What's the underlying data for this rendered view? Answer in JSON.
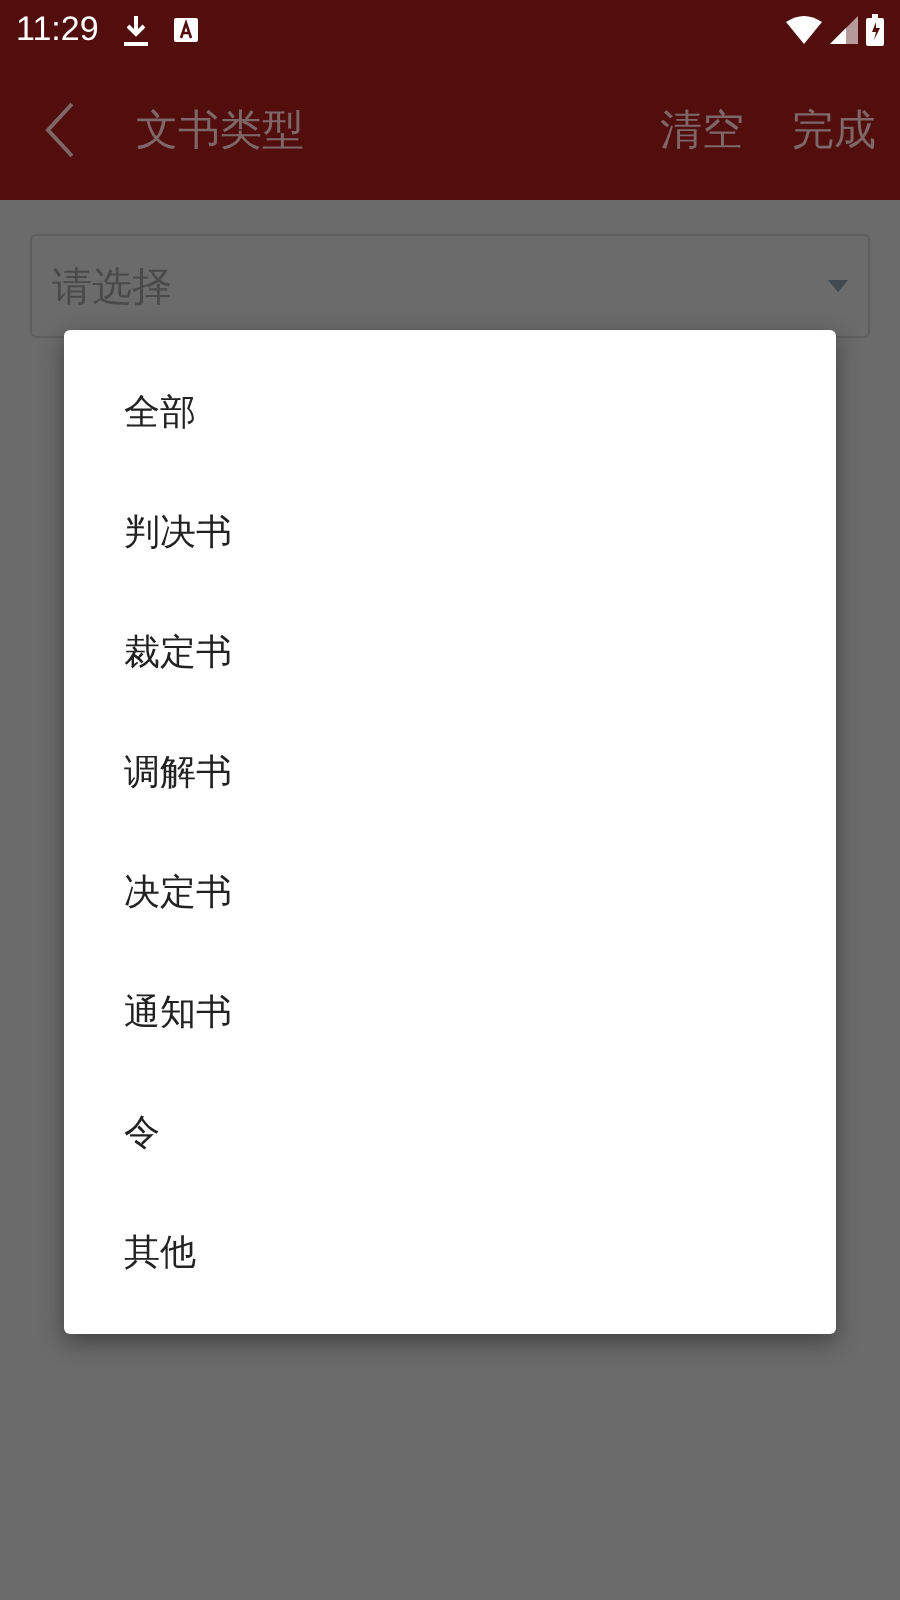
{
  "status_bar": {
    "time": "11:29"
  },
  "header": {
    "title": "文书类型",
    "actions": [
      "清空",
      "完成"
    ]
  },
  "select": {
    "placeholder": "请选择"
  },
  "menu": {
    "items": [
      "全部",
      "判决书",
      "裁定书",
      "调解书",
      "决定书",
      "通知书",
      "令",
      "其他"
    ]
  }
}
